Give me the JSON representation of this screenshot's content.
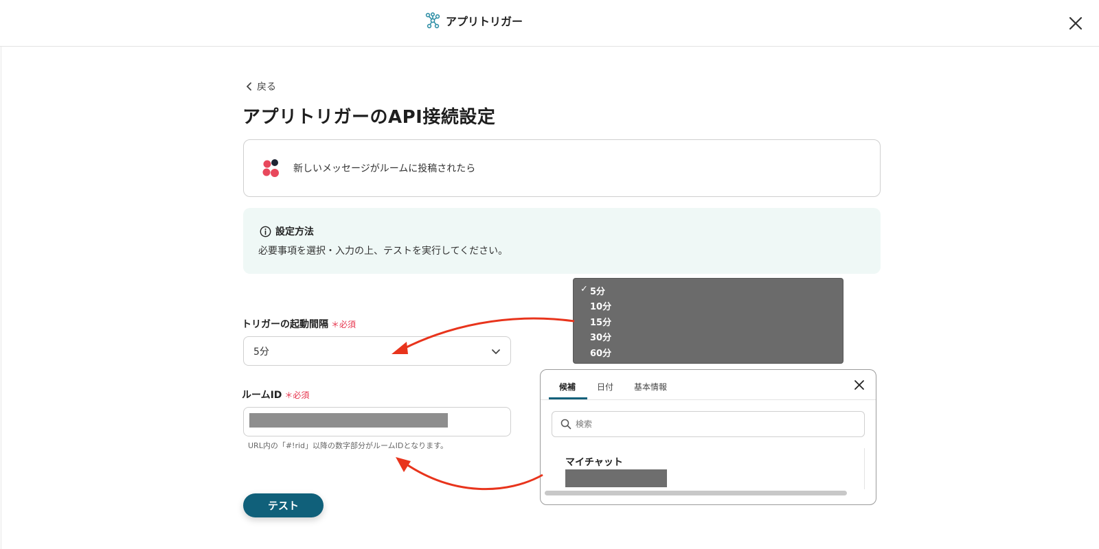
{
  "header": {
    "title": "アプリトリガー"
  },
  "nav": {
    "back_label": "戻る"
  },
  "page": {
    "title": "アプリトリガーのAPI接続設定"
  },
  "event": {
    "label": "新しいメッセージがルームに投稿されたら"
  },
  "info": {
    "heading": "設定方法",
    "body": "必要事項を選択・入力の上、テストを実行してください。"
  },
  "trigger_interval": {
    "label": "トリガーの起動間隔",
    "required": "＊必須",
    "selected": "5分",
    "options": [
      "5分",
      "10分",
      "15分",
      "30分",
      "60分"
    ]
  },
  "room_id": {
    "label": "ルームID",
    "required": "＊必須",
    "hint": "URL内の「#!rid」以降の数字部分がルームIDとなります。"
  },
  "test_button": {
    "label": "テスト"
  },
  "popup": {
    "tabs": [
      "候補",
      "日付",
      "基本情報"
    ],
    "search_placeholder": "検索",
    "items": [
      {
        "label": "マイチャット"
      }
    ]
  },
  "colors": {
    "accent": "#10607a",
    "required": "#e6324b",
    "arrow": "#e8341c",
    "info_bg": "#eff8f6"
  }
}
